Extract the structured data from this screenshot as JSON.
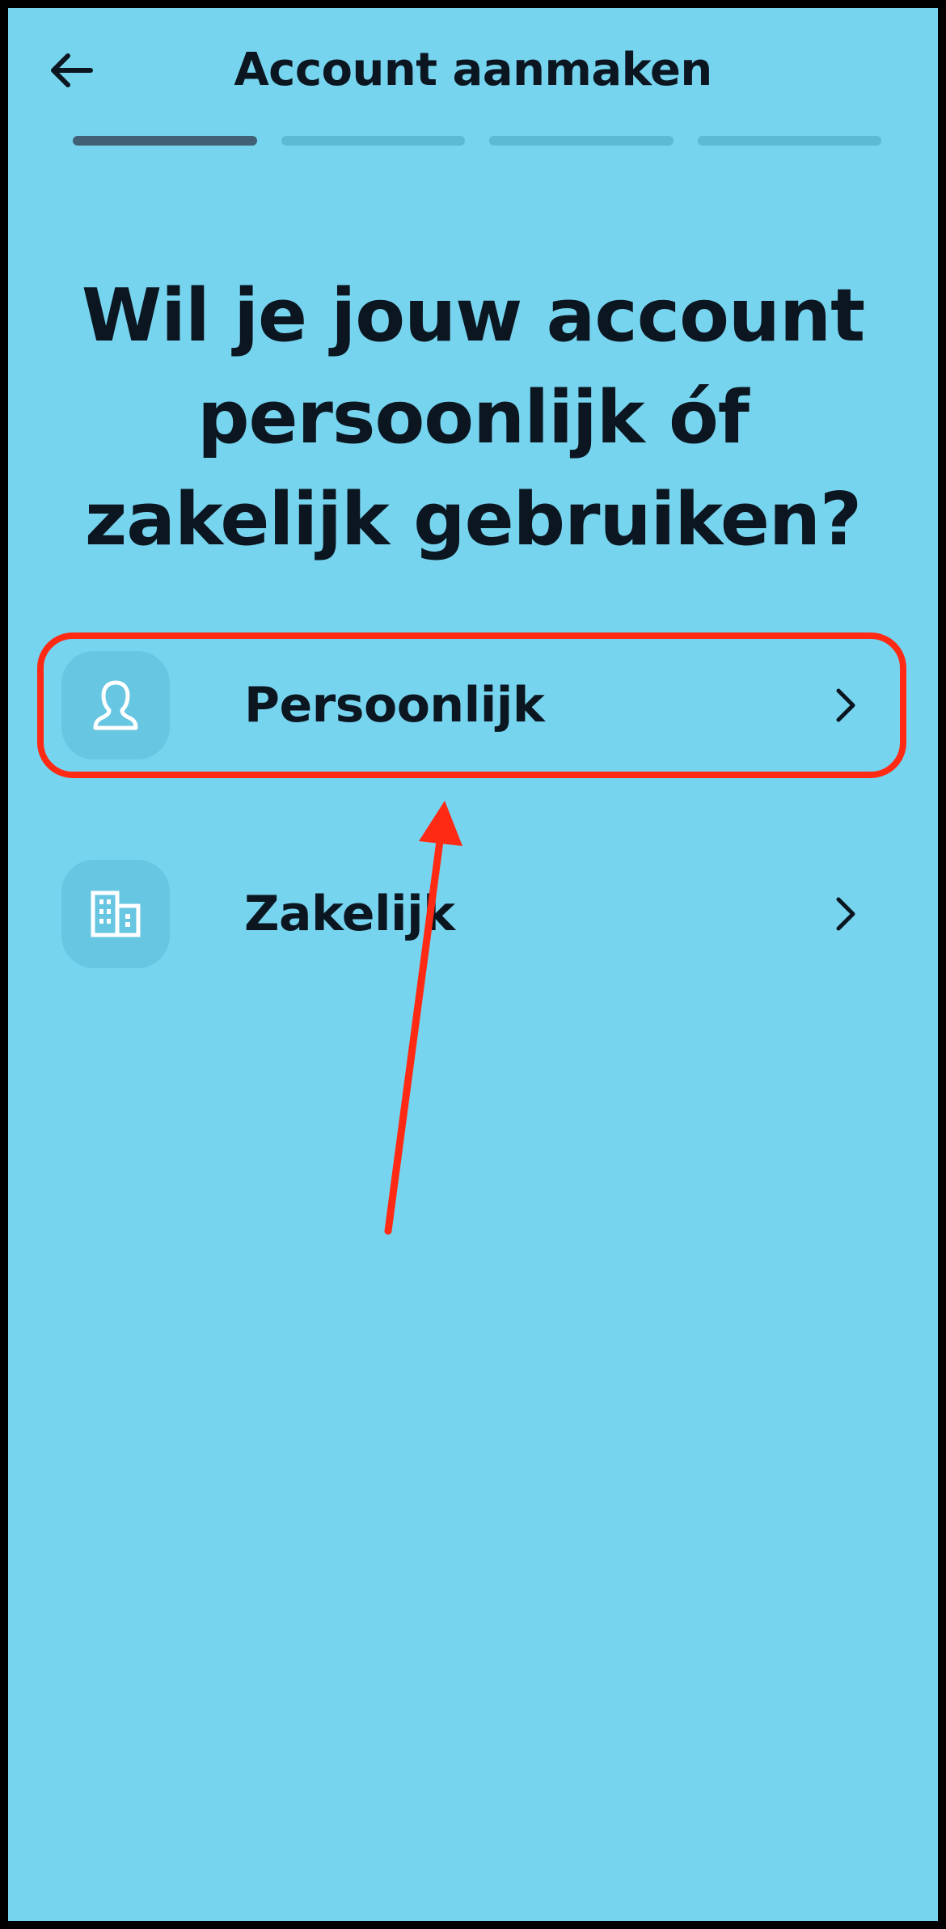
{
  "header": {
    "back_icon": "arrow-left-icon",
    "title": "Account aanmaken"
  },
  "progress": {
    "total_steps": 4,
    "current_step": 1
  },
  "question": "Wil je jouw account persoonlijk óf zakelijk gebruiken?",
  "options": [
    {
      "label": "Persoonlijk",
      "icon": "person-icon",
      "chevron": "chevron-right-icon",
      "highlighted": true
    },
    {
      "label": "Zakelijk",
      "icon": "building-icon",
      "chevron": "chevron-right-icon",
      "highlighted": false
    }
  ],
  "colors": {
    "background": "#77d4ef",
    "progress_active": "#3f6075",
    "progress_inactive": "#5cbad5",
    "icon_tile": "#67c6e2",
    "annotation": "#ff2a14",
    "text": "#0b1620"
  }
}
